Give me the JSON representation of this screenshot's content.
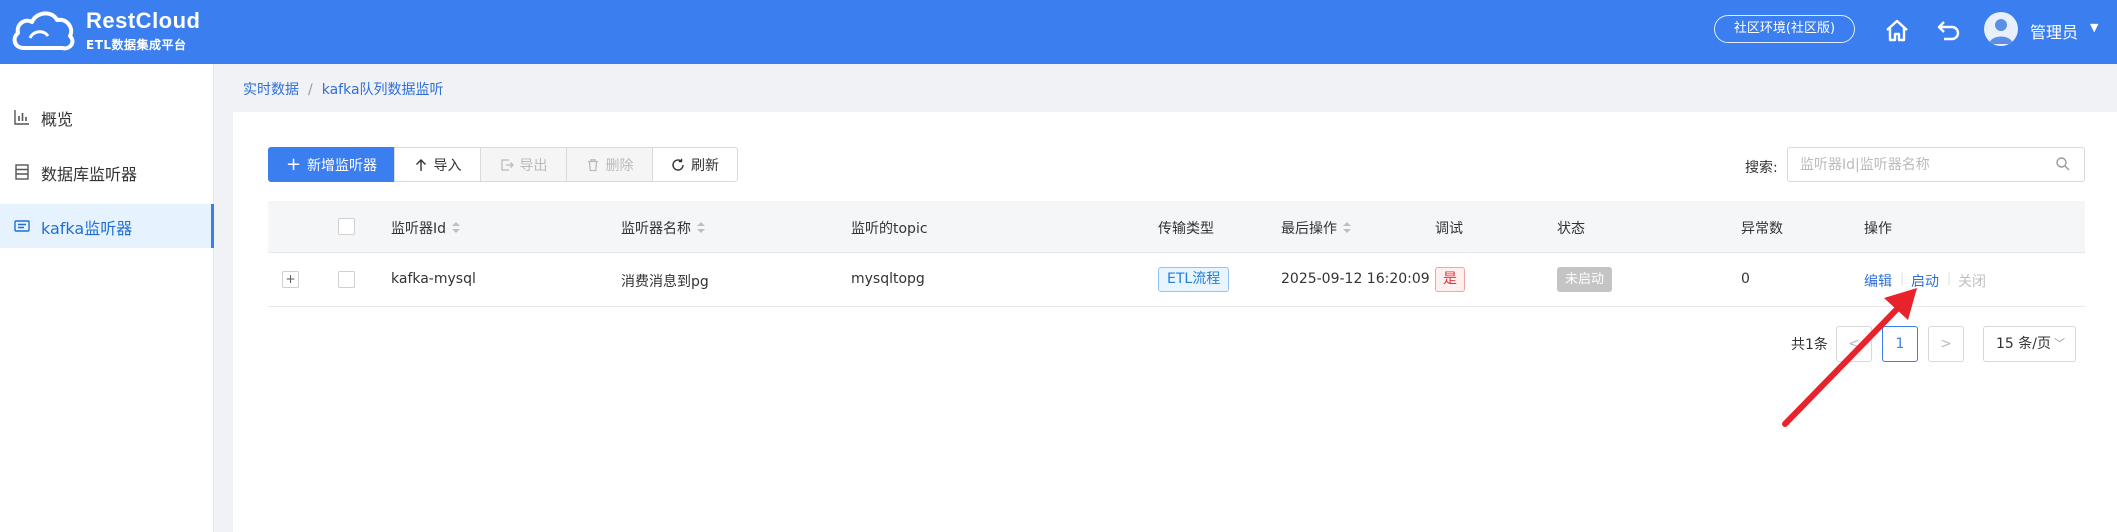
{
  "app": {
    "name": "RestCloud",
    "subtitle": "ETL数据集成平台"
  },
  "header": {
    "env_label": "社区环境(社区版)",
    "icons": [
      "home-icon",
      "undo-icon"
    ],
    "user_name": "管理员"
  },
  "sidebar": {
    "items": [
      {
        "label": "概览",
        "icon": "bar-chart-icon",
        "active": false
      },
      {
        "label": "数据库监听器",
        "icon": "database-icon",
        "active": false
      },
      {
        "label": "kafka监听器",
        "icon": "kafka-list-icon",
        "active": true
      }
    ]
  },
  "breadcrumb": {
    "items": [
      "实时数据",
      "kafka队列数据监听"
    ],
    "separator": "/"
  },
  "toolbar": {
    "add_label": "新增监听器",
    "import_label": "导入",
    "export_label": "导出",
    "delete_label": "删除",
    "refresh_label": "刷新",
    "search_label": "搜索:",
    "search_placeholder": "监听器Id|监听器名称"
  },
  "table": {
    "headers": {
      "listener_id": "监听器Id",
      "listener_name": "监听器名称",
      "topic": "监听的topic",
      "transfer_type": "传输类型",
      "last_op": "最后操作",
      "debug": "调试",
      "status": "状态",
      "errors": "异常数",
      "actions": "操作"
    },
    "rows": [
      {
        "expand": "+",
        "listener_id": "kafka-mysql",
        "listener_name": "消费消息到pg",
        "topic": "mysqltopg",
        "transfer_type": "ETL流程",
        "last_op": "2025-09-12 16:20:09",
        "debug": "是",
        "status": "未启动",
        "errors": "0",
        "actions": {
          "edit": "编辑",
          "start": "启动",
          "close": "关闭",
          "sep": "|"
        }
      }
    ]
  },
  "pagination": {
    "total": "共1条",
    "prev": "<",
    "current": "1",
    "next": ">",
    "page_size": "15 条/页"
  },
  "colors": {
    "header_bg": "#3b7ef0",
    "primary": "#3b7ef0",
    "annotation_arrow": "#e8232b"
  }
}
